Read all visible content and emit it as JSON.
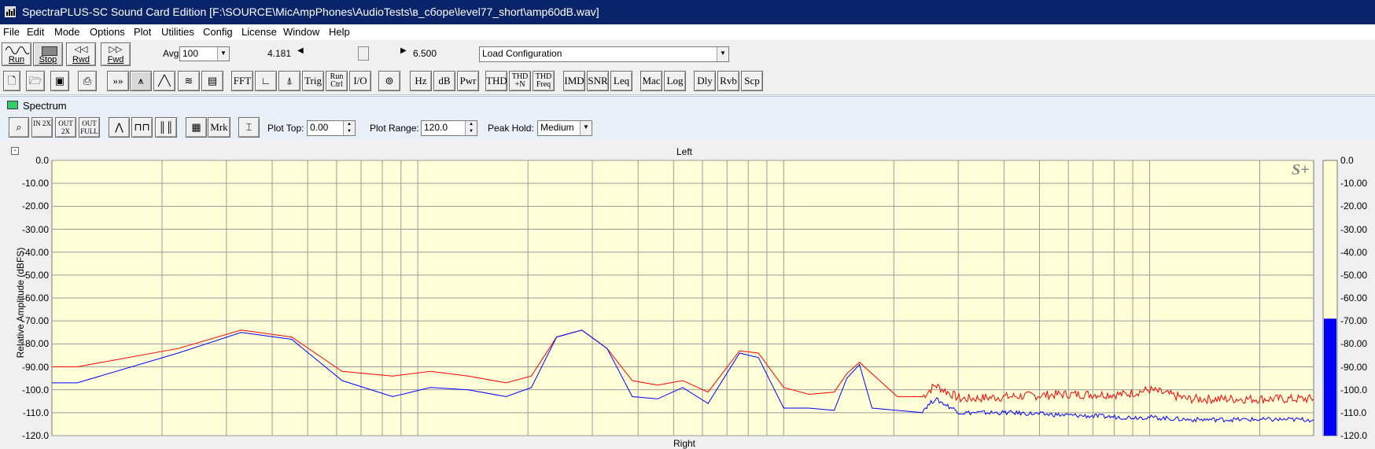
{
  "window": {
    "title": "SpectraPLUS-SC Sound Card Edition [F:\\SOURCE\\MicAmpPhones\\AudioTests\\в_сборе\\level77_short\\amp60dB.wav]"
  },
  "menu": [
    "File",
    "Edit",
    "Mode",
    "Options",
    "Plot",
    "Utilities",
    "Config",
    "License",
    "Window",
    "Help"
  ],
  "toolbar1": {
    "run_label": "Run",
    "stop_label": "Stop",
    "rwd_label": "Rwd",
    "fwd_label": "Fwd",
    "avg_label": "Avg",
    "avg_value": "100",
    "time_start": "4.181",
    "time_end": "6.500",
    "config_value": "Load Configuration"
  },
  "toolbar2": {
    "buttons": [
      "FFT",
      "Trig",
      "Run Ctrl",
      "I/O",
      "Hz",
      "dB",
      "Pwr",
      "THD",
      "THD +N",
      "THD Freq",
      "IMD",
      "SNR",
      "Leq",
      "Mac",
      "Log",
      "Dly",
      "Rvb",
      "Scp"
    ]
  },
  "spectrum": {
    "title": "Spectrum",
    "mrk_label": "Mrk",
    "zoom_in_2x": "IN 2X",
    "zoom_out_2x": "OUT 2X",
    "zoom_out_full": "OUT FULL",
    "plot_top_label": "Plot Top:",
    "plot_top_value": "0.00",
    "plot_range_label": "Plot Range:",
    "plot_range_value": "120.0",
    "peak_hold_label": "Peak Hold:",
    "peak_hold_value": "Medium",
    "channel_top": "Left",
    "channel_bottom": "Right",
    "ylabel": "Relative Amplitude (dBFS)",
    "logo": "S+",
    "collapse": "-"
  },
  "chart_data": {
    "type": "line",
    "ylabel": "Relative Amplitude (dBFS)",
    "ylim": [
      -120,
      0
    ],
    "yticks": [
      "0.0",
      "-10.00",
      "-20.00",
      "-30.00",
      "-40.00",
      "-50.00",
      "-60.00",
      "-70.00",
      "-80.00",
      "-90.00",
      "-100.0",
      "-110.0",
      "-120.0"
    ],
    "meter_ticks": [
      "0.0",
      "-10.00",
      "-20.00",
      "-30.00",
      "-40.00",
      "-50.00",
      "-60.00",
      "-70.00",
      "-80.00",
      "-90.00",
      "-100.0",
      "-110.0",
      "-120.0"
    ],
    "meter_level_db": -69,
    "xscale": "log",
    "grid": true,
    "series": [
      {
        "name": "Left",
        "color": "#ff0000",
        "points": [
          [
            0,
            -90
          ],
          [
            0.02,
            -90
          ],
          [
            0.1,
            -82
          ],
          [
            0.15,
            -74
          ],
          [
            0.19,
            -77
          ],
          [
            0.23,
            -92
          ],
          [
            0.27,
            -94
          ],
          [
            0.3,
            -92
          ],
          [
            0.33,
            -94
          ],
          [
            0.36,
            -97
          ],
          [
            0.38,
            -94
          ],
          [
            0.4,
            -77
          ],
          [
            0.42,
            -74
          ],
          [
            0.44,
            -82
          ],
          [
            0.46,
            -96
          ],
          [
            0.48,
            -98
          ],
          [
            0.5,
            -96
          ],
          [
            0.52,
            -101
          ],
          [
            0.545,
            -83
          ],
          [
            0.56,
            -84
          ],
          [
            0.58,
            -99
          ],
          [
            0.6,
            -102
          ],
          [
            0.62,
            -101
          ],
          [
            0.63,
            -93
          ],
          [
            0.64,
            -88
          ],
          [
            0.65,
            -93
          ],
          [
            0.67,
            -103
          ],
          [
            0.69,
            -103
          ],
          [
            0.7,
            -98
          ],
          [
            0.72,
            -104
          ],
          [
            0.76,
            -103
          ],
          [
            0.8,
            -102
          ],
          [
            0.85,
            -102
          ],
          [
            0.87,
            -100
          ],
          [
            0.9,
            -104
          ],
          [
            0.95,
            -104
          ],
          [
            1.0,
            -104
          ]
        ]
      },
      {
        "name": "Right",
        "color": "#0000ff",
        "points": [
          [
            0,
            -97
          ],
          [
            0.02,
            -97
          ],
          [
            0.1,
            -84
          ],
          [
            0.15,
            -75
          ],
          [
            0.19,
            -78
          ],
          [
            0.23,
            -96
          ],
          [
            0.27,
            -103
          ],
          [
            0.3,
            -99
          ],
          [
            0.33,
            -100
          ],
          [
            0.36,
            -103
          ],
          [
            0.38,
            -99
          ],
          [
            0.4,
            -77
          ],
          [
            0.42,
            -74
          ],
          [
            0.44,
            -82
          ],
          [
            0.46,
            -103
          ],
          [
            0.48,
            -104
          ],
          [
            0.5,
            -99
          ],
          [
            0.52,
            -106
          ],
          [
            0.545,
            -84
          ],
          [
            0.56,
            -86
          ],
          [
            0.58,
            -108
          ],
          [
            0.6,
            -108
          ],
          [
            0.62,
            -109
          ],
          [
            0.63,
            -95
          ],
          [
            0.64,
            -89
          ],
          [
            0.65,
            -108
          ],
          [
            0.67,
            -109
          ],
          [
            0.69,
            -109
          ],
          [
            0.7,
            -104
          ],
          [
            0.72,
            -110
          ],
          [
            0.76,
            -110
          ],
          [
            0.8,
            -111
          ],
          [
            0.85,
            -112
          ],
          [
            0.87,
            -112
          ],
          [
            0.9,
            -113
          ],
          [
            0.95,
            -113
          ],
          [
            1.0,
            -113
          ]
        ]
      }
    ]
  }
}
